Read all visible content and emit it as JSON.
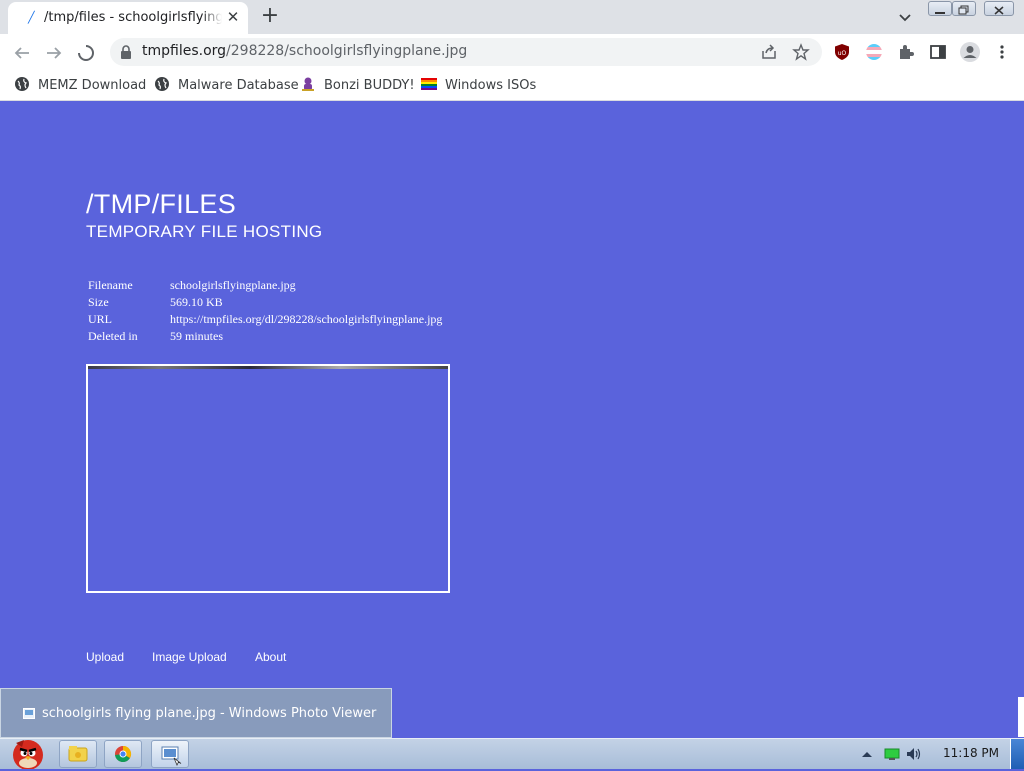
{
  "browser": {
    "tab": {
      "title": "/tmp/files - schoolgirlsflyingplane.jpg",
      "close": "✕"
    },
    "new_tab": "+",
    "address": {
      "host": "tmpfiles.org",
      "path": "/298228/schoolgirlsflyingplane.jpg"
    },
    "bookmarks": [
      {
        "label": "MEMZ Download",
        "icon": "globe-icon"
      },
      {
        "label": "Malware Database",
        "icon": "globe-icon"
      },
      {
        "label": "Bonzi BUDDY!",
        "icon": "bonzi-icon"
      },
      {
        "label": "Windows ISOs",
        "icon": "rainbow-flag-icon"
      }
    ]
  },
  "page": {
    "title": "/TMP/FILES",
    "subtitle": "TEMPORARY FILE HOSTING",
    "file_info": [
      {
        "label": "Filename",
        "value": "schoolgirlsflyingplane.jpg"
      },
      {
        "label": "Size",
        "value": "569.10 KB"
      },
      {
        "label": "URL",
        "value": "https://tmpfiles.org/dl/298228/schoolgirlsflyingplane.jpg"
      },
      {
        "label": "Deleted in",
        "value": "59 minutes"
      }
    ],
    "footer_links": [
      "Upload",
      "Image Upload",
      "About"
    ],
    "background_color": "#5a63dc"
  },
  "popup": {
    "label": "schoolgirls flying plane.jpg - Windows Photo Viewer"
  },
  "taskbar": {
    "clock": "11:18 PM"
  }
}
